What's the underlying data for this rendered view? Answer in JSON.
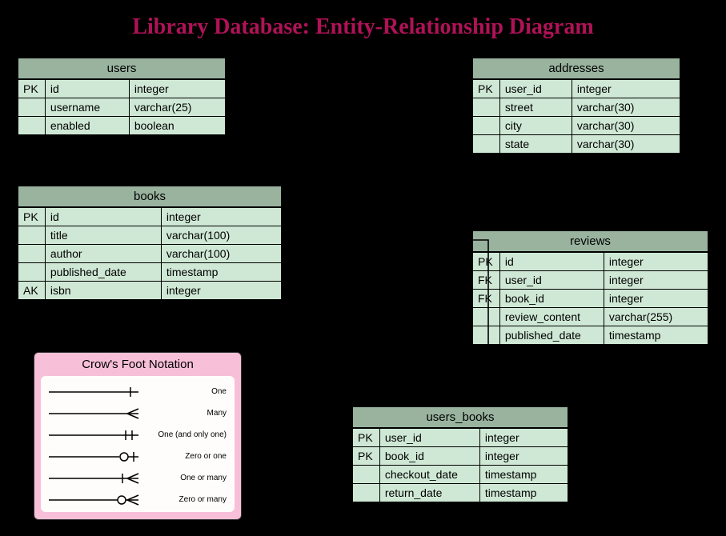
{
  "title": "Library Database: Entity-Relationship Diagram",
  "tables": {
    "users": {
      "name": "users",
      "rows": [
        {
          "key": "PK",
          "field": "id",
          "type": "integer"
        },
        {
          "key": "",
          "field": "username",
          "type": "varchar(25)"
        },
        {
          "key": "",
          "field": "enabled",
          "type": "boolean"
        }
      ]
    },
    "addresses": {
      "name": "addresses",
      "rows": [
        {
          "key": "PK",
          "field": "user_id",
          "type": "integer"
        },
        {
          "key": "",
          "field": "street",
          "type": "varchar(30)"
        },
        {
          "key": "",
          "field": "city",
          "type": "varchar(30)"
        },
        {
          "key": "",
          "field": "state",
          "type": "varchar(30)"
        }
      ]
    },
    "books": {
      "name": "books",
      "rows": [
        {
          "key": "PK",
          "field": "id",
          "type": "integer"
        },
        {
          "key": "",
          "field": "title",
          "type": "varchar(100)"
        },
        {
          "key": "",
          "field": "author",
          "type": "varchar(100)"
        },
        {
          "key": "",
          "field": "published_date",
          "type": "timestamp"
        },
        {
          "key": "AK",
          "field": "isbn",
          "type": "integer"
        }
      ]
    },
    "reviews": {
      "name": "reviews",
      "rows": [
        {
          "key": "PK",
          "field": "id",
          "type": "integer"
        },
        {
          "key": "FK",
          "field": "user_id",
          "type": "integer"
        },
        {
          "key": "FK",
          "field": "book_id",
          "type": "integer"
        },
        {
          "key": "",
          "field": "review_content",
          "type": "varchar(255)"
        },
        {
          "key": "",
          "field": "published_date",
          "type": "timestamp"
        }
      ]
    },
    "users_books": {
      "name": "users_books",
      "rows": [
        {
          "key": "PK",
          "field": "user_id",
          "type": "integer"
        },
        {
          "key": "PK",
          "field": "book_id",
          "type": "integer"
        },
        {
          "key": "",
          "field": "checkout_date",
          "type": "timestamp"
        },
        {
          "key": "",
          "field": "return_date",
          "type": "timestamp"
        }
      ]
    }
  },
  "legend": {
    "title": "Crow's Foot Notation",
    "items": [
      {
        "label": "One"
      },
      {
        "label": "Many"
      },
      {
        "label": "One (and only one)"
      },
      {
        "label": "Zero or one"
      },
      {
        "label": "One or many"
      },
      {
        "label": "Zero or many"
      }
    ]
  }
}
